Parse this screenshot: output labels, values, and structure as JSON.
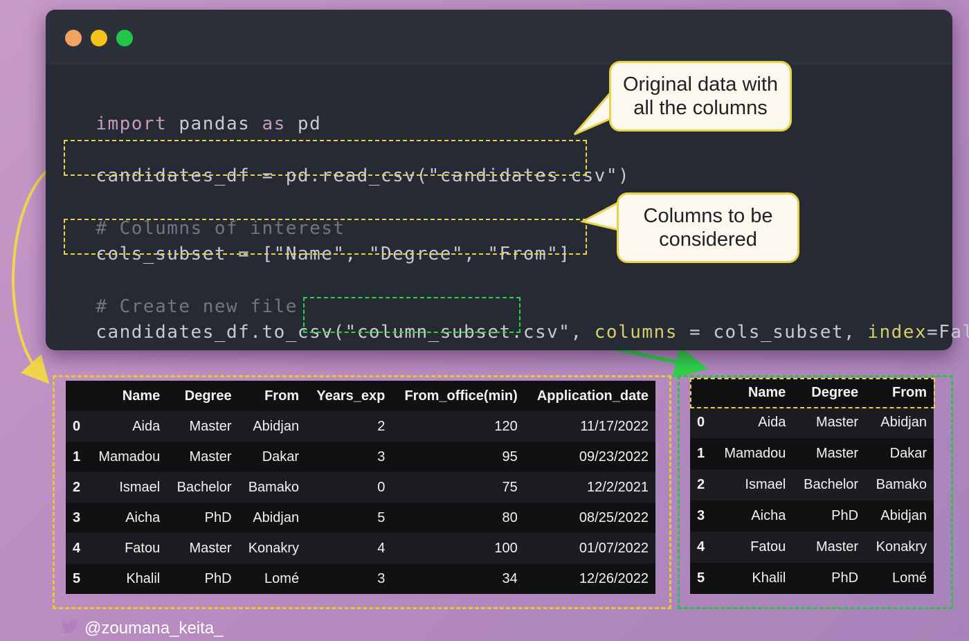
{
  "window": {
    "traffic_lights": [
      "#f1a361",
      "#f4c21a",
      "#20c54a"
    ]
  },
  "code": {
    "line1": {
      "a": "import",
      "b": " pandas ",
      "c": "as",
      "d": " pd"
    },
    "line2": {
      "a": "candidates_df = pd.read_csv(\"candidates.csv\")"
    },
    "comment1": "# Columns of interest",
    "line3": {
      "a": "cols_subset = [\"Name\", \"Degree\", \"From\"]"
    },
    "comment2": "# Create new file",
    "line4": {
      "a": "candidates_df.to_csv(",
      "b": "\"column_subset.csv\"",
      "c": ", ",
      "d": "columns",
      "e": " = ",
      "f": "cols_subset",
      "g": ", ",
      "h": "index",
      "i": "=False)"
    }
  },
  "callouts": {
    "original": [
      "Original data with",
      "all the columns"
    ],
    "columns": [
      "Columns to be",
      "considered"
    ]
  },
  "full_table": {
    "headers": [
      "",
      "Name",
      "Degree",
      "From",
      "Years_exp",
      "From_office(min)",
      "Application_date"
    ],
    "rows": [
      [
        "0",
        "Aida",
        "Master",
        "Abidjan",
        "2",
        "120",
        "11/17/2022"
      ],
      [
        "1",
        "Mamadou",
        "Master",
        "Dakar",
        "3",
        "95",
        "09/23/2022"
      ],
      [
        "2",
        "Ismael",
        "Bachelor",
        "Bamako",
        "0",
        "75",
        "12/2/2021"
      ],
      [
        "3",
        "Aicha",
        "PhD",
        "Abidjan",
        "5",
        "80",
        "08/25/2022"
      ],
      [
        "4",
        "Fatou",
        "Master",
        "Konakry",
        "4",
        "100",
        "01/07/2022"
      ],
      [
        "5",
        "Khalil",
        "PhD",
        "Lomé",
        "3",
        "34",
        "12/26/2022"
      ]
    ]
  },
  "subset_table": {
    "headers": [
      "",
      "Name",
      "Degree",
      "From"
    ],
    "rows": [
      [
        "0",
        "Aida",
        "Master",
        "Abidjan"
      ],
      [
        "1",
        "Mamadou",
        "Master",
        "Dakar"
      ],
      [
        "2",
        "Ismael",
        "Bachelor",
        "Bamako"
      ],
      [
        "3",
        "Aicha",
        "PhD",
        "Abidjan"
      ],
      [
        "4",
        "Fatou",
        "Master",
        "Konakry"
      ],
      [
        "5",
        "Khalil",
        "PhD",
        "Lomé"
      ]
    ]
  },
  "footer": {
    "handle": "@zoumana_keita_"
  }
}
